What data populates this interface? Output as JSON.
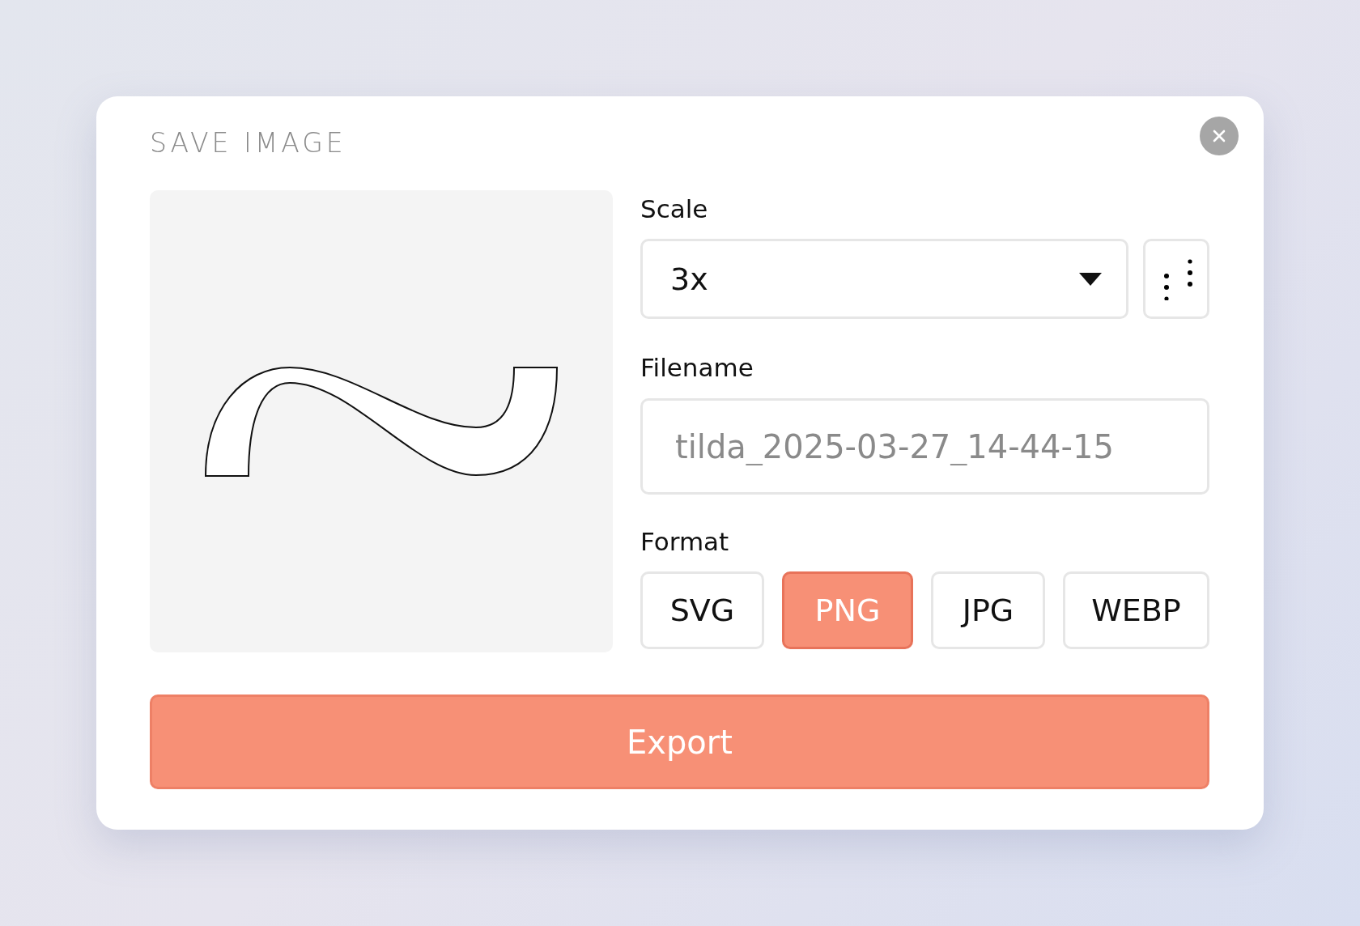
{
  "dialog": {
    "title": "SAVE IMAGE"
  },
  "scale": {
    "label": "Scale",
    "value": "3x"
  },
  "filename": {
    "label": "Filename",
    "placeholder": "tilda_2025-03-27_14-44-15"
  },
  "format": {
    "label": "Format",
    "options": [
      {
        "label": "SVG",
        "selected": false
      },
      {
        "label": "PNG",
        "selected": true
      },
      {
        "label": "JPG",
        "selected": false
      },
      {
        "label": "WEBP",
        "selected": false
      }
    ]
  },
  "export_button": "Export"
}
